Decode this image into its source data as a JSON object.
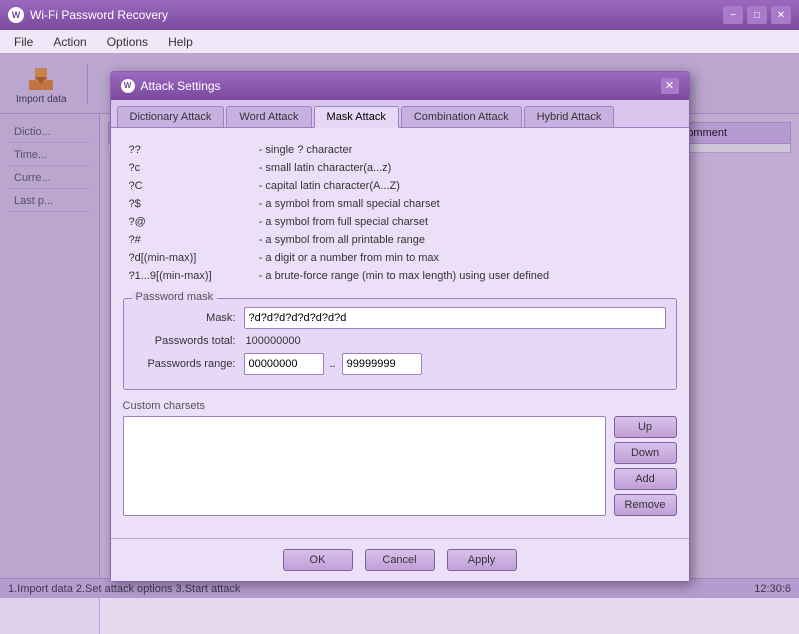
{
  "app": {
    "title": "Wi-Fi Password Recovery",
    "icon": "W"
  },
  "titlebar": {
    "buttons": {
      "minimize": "−",
      "restore": "□",
      "close": "✕"
    }
  },
  "menu": {
    "items": [
      "File",
      "Action",
      "Options",
      "Help"
    ]
  },
  "toolbar": {
    "import_label": "Import data"
  },
  "dialog": {
    "title": "Attack Settings",
    "close_btn": "✕",
    "tabs": [
      {
        "label": "Dictionary Attack",
        "active": false
      },
      {
        "label": "Word Attack",
        "active": false
      },
      {
        "label": "Mask Attack",
        "active": true
      },
      {
        "label": "Combination Attack",
        "active": false
      },
      {
        "label": "Hybrid Attack",
        "active": false
      }
    ],
    "legend": [
      {
        "code": "??",
        "desc": "- single ? character"
      },
      {
        "code": "?c",
        "desc": "- small latin character(a...z)"
      },
      {
        "code": "?C",
        "desc": "- capital latin character(A...Z)"
      },
      {
        "code": "?$",
        "desc": "- a symbol from small special charset"
      },
      {
        "code": "?@",
        "desc": "- a symbol from full special charset"
      },
      {
        "code": "?#",
        "desc": "- a symbol from all printable range"
      },
      {
        "code": "?d[(min-max)]",
        "desc": "- a digit or a number from min to max"
      },
      {
        "code": "?1...9[(min-max)]",
        "desc": "- a brute-force range (min to max length) using user defined"
      }
    ],
    "password_mask": {
      "legend": "Password mask",
      "mask_label": "Mask:",
      "mask_value": "?d?d?d?d?d?d?d?d",
      "total_label": "Passwords total:",
      "total_value": "100000000",
      "range_label": "Passwords range:",
      "range_from": "00000000",
      "range_to": "99999999"
    },
    "custom_charsets": {
      "label": "Custom charsets"
    },
    "charset_buttons": {
      "up": "Up",
      "down": "Down",
      "add": "Add",
      "remove": "Remove"
    },
    "footer_buttons": {
      "ok": "OK",
      "cancel": "Cancel",
      "apply": "Apply"
    }
  },
  "table": {
    "columns": [
      "Dictionary",
      "Times",
      "Current password",
      "Last password",
      "Comment"
    ]
  },
  "statusbar": {
    "text": "1.Import data  2.Set attack options  3.Start attack",
    "time": "12:30:6"
  }
}
